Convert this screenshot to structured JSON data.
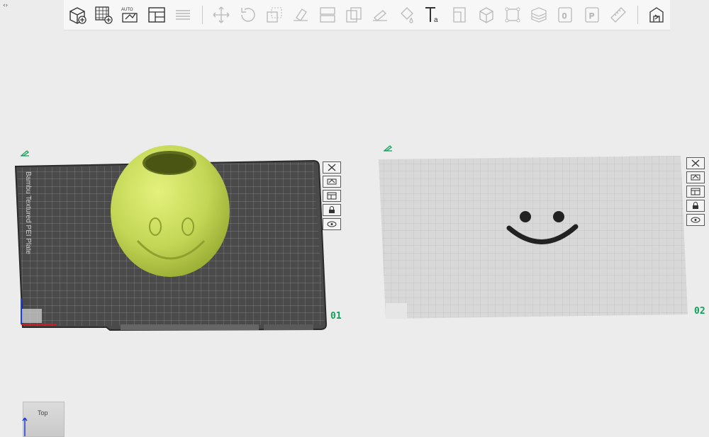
{
  "toolbar": {
    "groups": [
      [
        "add-object-icon",
        "add-plate-icon",
        "auto-arrange-icon",
        "split-view-icon",
        "layers-icon"
      ],
      [
        "move-icon",
        "rotate-icon",
        "scale-icon",
        "lay-on-face-icon",
        "split-to-parts-icon",
        "cut-icon",
        "support-paint-icon",
        "color-paint-icon",
        "text-tool-icon",
        "boolean-icon",
        "cube-icon",
        "measure-icon",
        "variable-layer-icon",
        "assembly-icon",
        "emboss-icon",
        "ruler-icon"
      ],
      [
        "return-icon"
      ]
    ],
    "auto_label": "AUTO",
    "text_tool_glyph": "Ta",
    "zero_glyph": "0",
    "p_glyph": "P"
  },
  "plates": [
    {
      "number": "01",
      "bed_label": "Bambu Textured PEI Plate",
      "bed_color": "#4a4a4a"
    },
    {
      "number": "02",
      "bed_color": "#d6d6d6"
    }
  ],
  "plate_buttons": [
    "close-icon",
    "arrange-plate-icon",
    "plate-settings-icon",
    "lock-icon",
    "view-eye-icon"
  ],
  "model_color": "#c9dd5e",
  "view_cube": {
    "label": "Top"
  },
  "collapse_glyph": "‹›"
}
